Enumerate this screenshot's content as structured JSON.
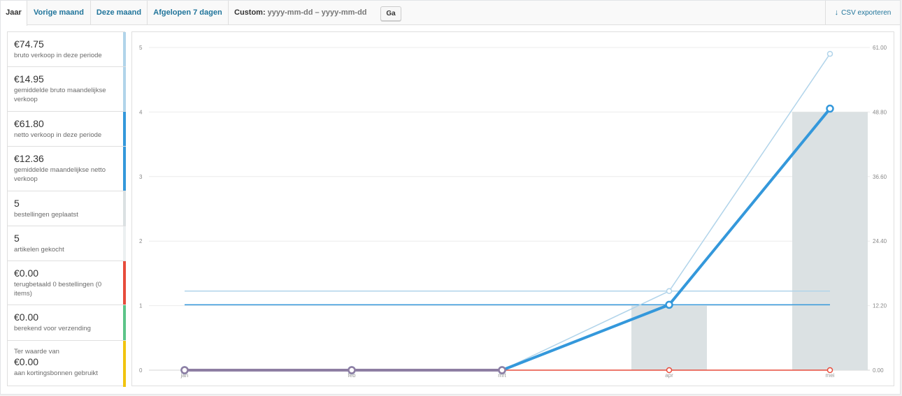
{
  "tabs": [
    {
      "label": "Jaar",
      "active": true
    },
    {
      "label": "Vorige maand",
      "active": false
    },
    {
      "label": "Deze maand",
      "active": false
    },
    {
      "label": "Afgelopen 7 dagen",
      "active": false
    }
  ],
  "custom": {
    "label": "Custom:",
    "from_placeholder": "yyyy-mm-dd",
    "separator": "–",
    "to_placeholder": "yyyy-mm-dd",
    "go_label": "Ga"
  },
  "export": {
    "label": "CSV exporteren",
    "icon": "download-arrow-icon"
  },
  "legend": [
    {
      "amount": "€74.75",
      "desc": "bruto verkoop in deze periode",
      "color": "#b1d4ea"
    },
    {
      "amount": "€14.95",
      "desc": "gemiddelde bruto maandelijkse verkoop",
      "color": "#b1d4ea"
    },
    {
      "amount": "€61.80",
      "desc": "netto verkoop in deze periode",
      "color": "#3498db"
    },
    {
      "amount": "€12.36",
      "desc": "gemiddelde maandelijkse netto verkoop",
      "color": "#3498db"
    },
    {
      "amount": "5",
      "desc": "bestellingen geplaatst",
      "color": "#dbe1e3"
    },
    {
      "amount": "5",
      "desc": "artikelen gekocht",
      "color": "#ecf0f1"
    },
    {
      "amount": "€0.00",
      "desc": "terugbetaald 0 bestellingen (0 items)",
      "color": "#e74c3c"
    },
    {
      "amount": "€0.00",
      "desc": "berekend voor verzending",
      "color": "#5cc488"
    },
    {
      "pre": "Ter waarde van",
      "amount": "€0.00",
      "desc": "aan kortingsbonnen gebruikt",
      "color": "#f1c40f"
    }
  ],
  "chart_data": {
    "type": "line",
    "categories": [
      "jan",
      "feb",
      "mrt",
      "apr",
      "mei"
    ],
    "left_axis": {
      "ticks": [
        "0",
        "1",
        "2",
        "3",
        "4",
        "5"
      ],
      "range": [
        0,
        5
      ]
    },
    "right_axis": {
      "ticks": [
        "0.00",
        "12.20",
        "24.40",
        "36.60",
        "48.80",
        "61.00"
      ],
      "range": [
        0,
        61
      ]
    },
    "bars": {
      "axis": "left",
      "values": [
        0,
        0,
        0,
        1,
        4
      ],
      "color": "#dbe1e3"
    },
    "series": [
      {
        "axis": "right",
        "values": [
          0,
          0,
          0,
          14.95,
          59.8
        ],
        "color": "#b1d4ea",
        "style": "thin"
      },
      {
        "axis": "right",
        "values": [
          0,
          0,
          0,
          12.36,
          49.44
        ],
        "color": "#3498db",
        "style": "thick"
      },
      {
        "axis": "right",
        "values": [
          0,
          0,
          0,
          0,
          0
        ],
        "color": "#e74c3c",
        "style": "thin"
      },
      {
        "axis": "left",
        "values": [
          0,
          0,
          0,
          null,
          null
        ],
        "color": "#8e7ea3",
        "style": "thick"
      }
    ],
    "average_lines": [
      {
        "axis": "right",
        "value": 14.95,
        "color": "#b1d4ea"
      },
      {
        "axis": "right",
        "value": 12.36,
        "color": "#3498db"
      }
    ]
  }
}
